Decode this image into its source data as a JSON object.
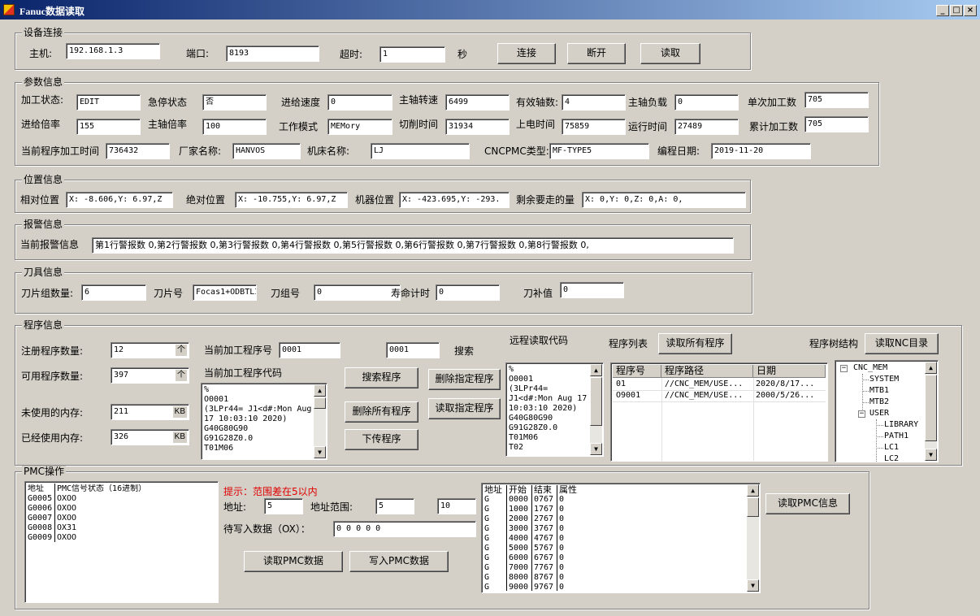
{
  "window": {
    "title": "Fanuc数据读取",
    "min": "_",
    "max": "□",
    "close": "×"
  },
  "connection": {
    "legend": "设备连接",
    "host_label": "主机:",
    "host": "192.168.1.3",
    "port_label": "端口:",
    "port": "8193",
    "timeout_label": "超时:",
    "timeout": "1",
    "timeout_unit": "秒",
    "connect": "连接",
    "disconnect": "断开",
    "read": "读取"
  },
  "params": {
    "legend": "参数信息",
    "proc_state_label": "加工状态:",
    "proc_state": "EDIT",
    "estop_label": "急停状态",
    "estop": "否",
    "feed_speed_label": "进给速度",
    "feed_speed": "0",
    "spindle_speed_label": "主轴转速",
    "spindle_speed": "6499",
    "axes_label": "有效轴数:",
    "axes": "4",
    "spindle_load_label": "主轴负载",
    "spindle_load": "0",
    "single_count_label": "单次加工数",
    "single_count": "705",
    "feed_rate_label": "进给倍率",
    "feed_rate": "155",
    "spindle_rate_label": "主轴倍率",
    "spindle_rate": "100",
    "mode_label": "工作模式",
    "mode": "MEMory",
    "cut_time_label": "切削时间",
    "cut_time": "31934",
    "power_time_label": "上电时间",
    "power_time": "75859",
    "run_time_label": "运行时间",
    "run_time": "27489",
    "total_count_label": "累计加工数",
    "total_count": "705",
    "prog_time_label": "当前程序加工时间",
    "prog_time": "736432",
    "vendor_label": "厂家名称:",
    "vendor": "HANVOS",
    "machine_label": "机床名称:",
    "machine": "LJ",
    "pmc_type_label": "CNCPMC类型:",
    "pmc_type": "MF-TYPE5",
    "date_label": "编程日期:",
    "date": "2019-11-20"
  },
  "position": {
    "legend": "位置信息",
    "rel_label": "相对位置",
    "rel": "X:  -8.606,Y:  6.97,Z",
    "abs_label": "绝对位置",
    "abs": "X:  -10.755,Y:  6.97,Z",
    "mach_label": "机器位置",
    "mach": "X:  -423.695,Y:  -293.",
    "remain_label": "剩余要走的量",
    "remain": "X:  0,Y:  0,Z:  0,A:  0,"
  },
  "alarm": {
    "legend": "报警信息",
    "label": "当前报警信息",
    "value": "第1行警报数 0,第2行警报数 0,第3行警报数 0,第4行警报数 0,第5行警报数 0,第6行警报数 0,第7行警报数 0,第8行警报数 0,"
  },
  "tool": {
    "legend": "刀具信息",
    "group_count_label": "刀片组数量:",
    "group_count": "6",
    "tool_no_label": "刀片号",
    "tool_no": "Focas1+ODBTLI",
    "group_no_label": "刀组号",
    "group_no": "0",
    "life_label": "寿命计时",
    "life": "0",
    "comp_label": "刀补值",
    "comp": "0"
  },
  "program": {
    "legend": "程序信息",
    "reg_label": "注册程序数量:",
    "reg": "12",
    "reg_unit": "个",
    "avail_label": "可用程序数量:",
    "avail": "397",
    "avail_unit": "个",
    "unused_label": "未使用的内存:",
    "unused": "211",
    "unused_unit": "KB",
    "used_label": "已经使用内存:",
    "used": "326",
    "used_unit": "KB",
    "cur_no_label": "当前加工程序号",
    "cur_no": "0001",
    "search_value": "0001",
    "search_label": "搜索",
    "cur_code_label": "当前加工程序代码",
    "cur_code": [
      "%",
      "O0001",
      "(3LPr44= J1<d#:Mon Aug",
      "17 10:03:10 2020)",
      "G40G80G90",
      "G91G28Z0.0",
      "T01M06"
    ],
    "btn_search": "搜索程序",
    "btn_delete_one": "删除指定程序",
    "btn_delete_all": "删除所有程序",
    "btn_read_one": "读取指定程序",
    "btn_upload": "下传程序",
    "remote_label": "远程读取代码",
    "remote_code": [
      "%",
      "O0001",
      "(3LPr44=",
      "J1<d#:Mon Aug 17",
      "10:03:10 2020)",
      "G40G80G90",
      "G91G28Z0.0",
      "T01M06",
      "T02"
    ],
    "list_label": "程序列表",
    "btn_read_all": "读取所有程序",
    "list_headers": [
      "程序号",
      "程序路径",
      "日期"
    ],
    "list_rows": [
      {
        "no": "01",
        "path": "//CNC_MEM/USE...",
        "date": "2020/8/17..."
      },
      {
        "no": "O9001",
        "path": "//CNC_MEM/USE...",
        "date": "2000/5/26..."
      }
    ],
    "tree_label": "程序树结构",
    "btn_read_nc": "读取NC目录",
    "tree": {
      "root": "CNC_MEM",
      "system": "SYSTEM",
      "mtb1": "MTB1",
      "mtb2": "MTB2",
      "user": "USER",
      "library": "LIBRARY",
      "path1": "PATH1",
      "lc1": "LC1",
      "lc2": "LC2"
    }
  },
  "pmc": {
    "legend": "PMC操作",
    "list_header_addr": "地址",
    "list_header_state": "PMC信号状态（16进制）",
    "list_rows": [
      {
        "addr": "G0005",
        "val": "OXOO"
      },
      {
        "addr": "G0006",
        "val": "OXOO"
      },
      {
        "addr": "G0007",
        "val": "OXOO"
      },
      {
        "addr": "G0008",
        "val": "OX31"
      },
      {
        "addr": "G0009",
        "val": "OXOO"
      }
    ],
    "hint": "提示：范围差在5以内",
    "addr_label": "地址:",
    "addr": "5",
    "range_label": "地址范围:",
    "range_from": "5",
    "range_to": "10",
    "write_label": "待写入数据（OX）：",
    "write_value": "0 0 0 0 0",
    "btn_read": "读取PMC数据",
    "btn_write": "写入PMC数据",
    "table_headers": [
      "地址",
      "开始",
      "结束",
      "属性"
    ],
    "table_rows": [
      [
        "G",
        "0000",
        "0767",
        "0"
      ],
      [
        "G",
        "1000",
        "1767",
        "0"
      ],
      [
        "G",
        "2000",
        "2767",
        "0"
      ],
      [
        "G",
        "3000",
        "3767",
        "0"
      ],
      [
        "G",
        "4000",
        "4767",
        "0"
      ],
      [
        "G",
        "5000",
        "5767",
        "0"
      ],
      [
        "G",
        "6000",
        "6767",
        "0"
      ],
      [
        "G",
        "7000",
        "7767",
        "0"
      ],
      [
        "G",
        "8000",
        "8767",
        "0"
      ],
      [
        "G",
        "9000",
        "9767",
        "0"
      ]
    ],
    "btn_info": "读取PMC信息"
  }
}
